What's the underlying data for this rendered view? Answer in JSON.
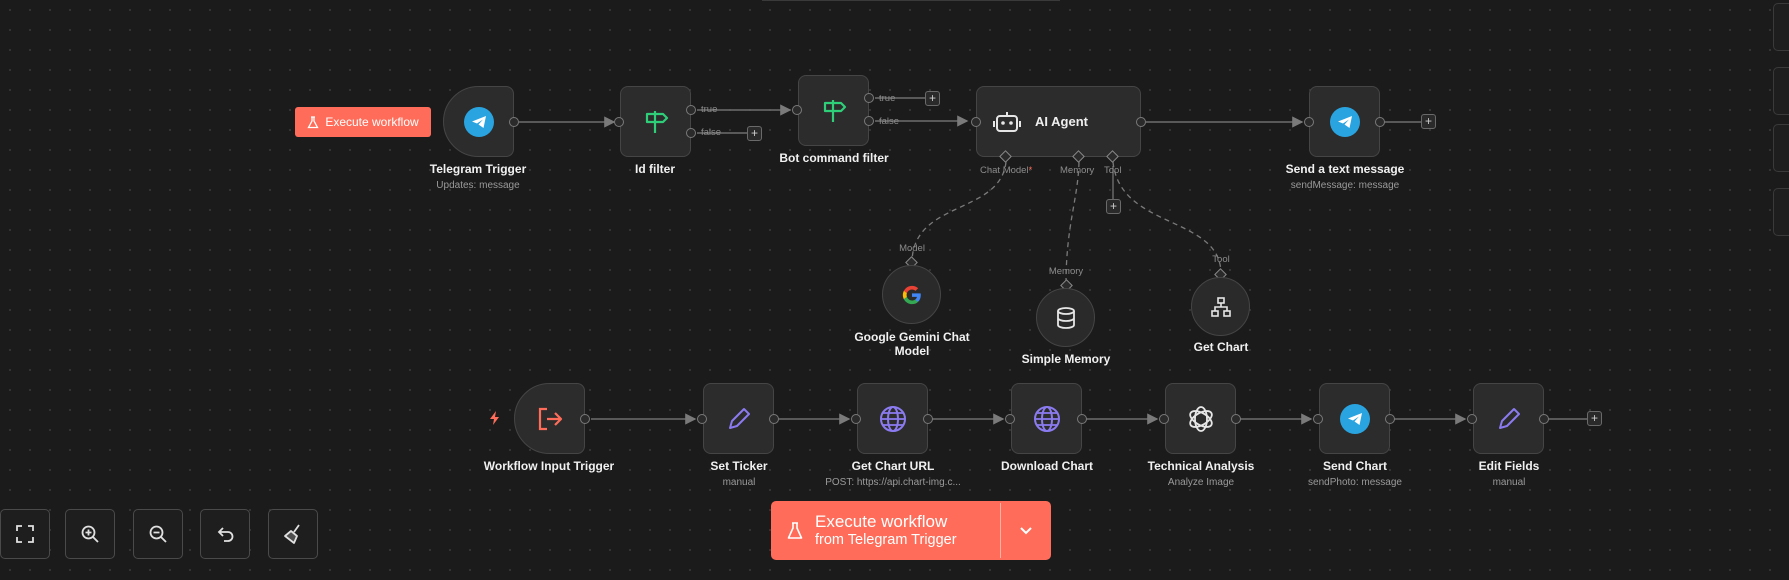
{
  "workflow": {
    "execute_small_label": "Execute workflow",
    "trigger_node": {
      "title": "Telegram Trigger",
      "subtitle": "Updates: message",
      "icon": "telegram-icon"
    },
    "id_filter": {
      "title": "Id filter",
      "icon": "signpost-icon",
      "out_true": "true",
      "out_false": "false"
    },
    "bot_command_filter": {
      "title": "Bot command filter",
      "icon": "signpost-icon",
      "out_true": "true",
      "out_false": "false"
    },
    "ai_agent": {
      "title": "AI Agent",
      "icon": "robot-icon",
      "conn_chat_model": "Chat Model",
      "conn_required_mark": "*",
      "conn_memory": "Memory",
      "conn_tool": "Tool"
    },
    "send_text": {
      "title": "Send a text message",
      "subtitle": "sendMessage: message",
      "icon": "telegram-icon"
    },
    "gemini": {
      "title": "Google Gemini Chat Model",
      "input_label": "Model",
      "icon": "google-icon"
    },
    "memory": {
      "title": "Simple Memory",
      "input_label": "Memory",
      "icon": "database-icon"
    },
    "get_chart": {
      "title": "Get Chart",
      "input_label": "Tool",
      "icon": "sitemap-icon"
    },
    "workflow_input": {
      "title": "Workflow Input Trigger",
      "icon": "sign-in-icon"
    },
    "set_ticker": {
      "title": "Set Ticker",
      "subtitle": "manual",
      "icon": "pencil-icon"
    },
    "get_chart_url": {
      "title": "Get Chart URL",
      "subtitle": "POST: https://api.chart-img.c...",
      "icon": "globe-icon"
    },
    "download_chart": {
      "title": "Download Chart",
      "icon": "globe-icon"
    },
    "technical_analysis": {
      "title": "Technical Analysis",
      "subtitle": "Analyze Image",
      "icon": "openai-icon"
    },
    "send_chart": {
      "title": "Send Chart",
      "subtitle": "sendPhoto: message",
      "icon": "telegram-icon"
    },
    "edit_fields": {
      "title": "Edit Fields",
      "subtitle": "manual",
      "icon": "pencil-icon"
    },
    "plus_symbol": "+"
  },
  "execute_main": {
    "line1": "Execute workflow",
    "line2": "from Telegram Trigger",
    "icon": "flask-icon",
    "dropdown_icon": "chevron-down-icon"
  },
  "controls": [
    {
      "name": "fit-view",
      "icon": "maximize-icon"
    },
    {
      "name": "zoom-in",
      "icon": "zoom-in-icon"
    },
    {
      "name": "zoom-out",
      "icon": "zoom-out-icon"
    },
    {
      "name": "undo",
      "icon": "undo-icon"
    },
    {
      "name": "tidy-up",
      "icon": "broom-icon"
    }
  ],
  "colors": {
    "canvas_bg": "#1b1b1b",
    "node_bg": "#2c2c2c",
    "accent": "#ff6d5a",
    "telegram": "#2aa4e0",
    "filter_green": "#2fcf79",
    "tool_purple": "#8b7bf0",
    "edge": "#6e6e6e"
  }
}
